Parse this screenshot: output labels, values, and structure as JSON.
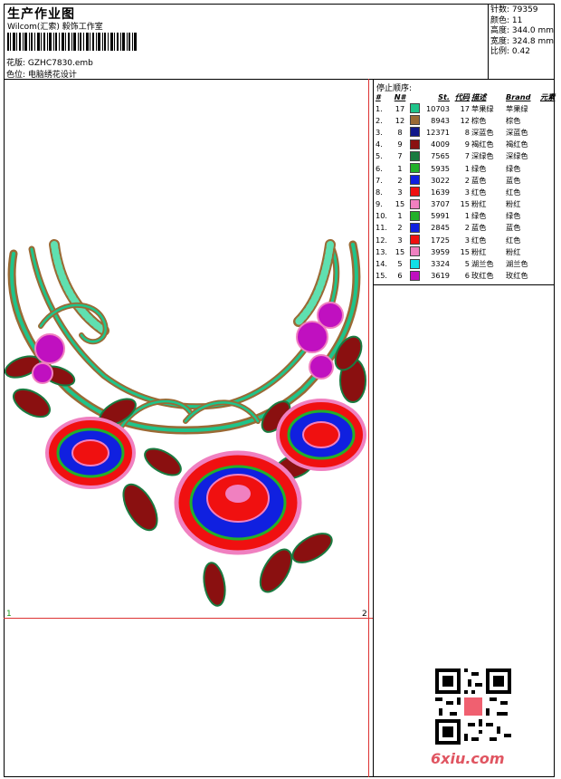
{
  "header": {
    "title": "生产作业图",
    "company": "Wilcom(汇索) 毅饰工作室",
    "pattern_label": "花版:",
    "pattern_value": "GZHC7830.emb",
    "color_label": "色位:",
    "color_value": "电脑绣花设计"
  },
  "stats": {
    "stitches": "针数: 79359",
    "colors": "颜色: 11",
    "height": "高度: 344.0 mm",
    "width": "宽度: 324.8 mm",
    "scale": "比例: 0.42"
  },
  "sequence": {
    "title": "停止顺序:",
    "headers": [
      "#",
      "N#",
      "St.",
      "代码",
      "描述",
      "Brand",
      "元素"
    ],
    "rows": [
      {
        "idx": "1.",
        "n": "17",
        "color": "#1fc48a",
        "st": "10703",
        "code": "17",
        "desc": "苹果绿",
        "brand": "苹果绿"
      },
      {
        "idx": "2.",
        "n": "12",
        "color": "#9a6a35",
        "st": "8943",
        "code": "12",
        "desc": "棕色",
        "brand": "棕色"
      },
      {
        "idx": "3.",
        "n": "8",
        "color": "#10188a",
        "st": "12371",
        "code": "8",
        "desc": "深蓝色",
        "brand": "深蓝色"
      },
      {
        "idx": "4.",
        "n": "9",
        "color": "#8a1010",
        "st": "4009",
        "code": "9",
        "desc": "褐红色",
        "brand": "褐红色"
      },
      {
        "idx": "5.",
        "n": "7",
        "color": "#1a7a40",
        "st": "7565",
        "code": "7",
        "desc": "深绿色",
        "brand": "深绿色"
      },
      {
        "idx": "6.",
        "n": "1",
        "color": "#22b02a",
        "st": "5935",
        "code": "1",
        "desc": "绿色",
        "brand": "绿色"
      },
      {
        "idx": "7.",
        "n": "2",
        "color": "#1020e0",
        "st": "3022",
        "code": "2",
        "desc": "蓝色",
        "brand": "蓝色"
      },
      {
        "idx": "8.",
        "n": "3",
        "color": "#f01010",
        "st": "1639",
        "code": "3",
        "desc": "红色",
        "brand": "红色"
      },
      {
        "idx": "9.",
        "n": "15",
        "color": "#f080c0",
        "st": "3707",
        "code": "15",
        "desc": "粉红",
        "brand": "粉红"
      },
      {
        "idx": "10.",
        "n": "1",
        "color": "#22b02a",
        "st": "5991",
        "code": "1",
        "desc": "绿色",
        "brand": "绿色"
      },
      {
        "idx": "11.",
        "n": "2",
        "color": "#1020e0",
        "st": "2845",
        "code": "2",
        "desc": "蓝色",
        "brand": "蓝色"
      },
      {
        "idx": "12.",
        "n": "3",
        "color": "#f01010",
        "st": "1725",
        "code": "3",
        "desc": "红色",
        "brand": "红色"
      },
      {
        "idx": "13.",
        "n": "15",
        "color": "#f080c0",
        "st": "3959",
        "code": "15",
        "desc": "粉红",
        "brand": "粉红"
      },
      {
        "idx": "14.",
        "n": "5",
        "color": "#10e0e8",
        "st": "3324",
        "code": "5",
        "desc": "湖兰色",
        "brand": "湖兰色"
      },
      {
        "idx": "15.",
        "n": "6",
        "color": "#c010c0",
        "st": "3619",
        "code": "6",
        "desc": "玫红色",
        "brand": "玫红色"
      }
    ]
  },
  "canvas": {
    "marker_left": "1",
    "marker_right": "2"
  },
  "footer": {
    "brand": "6xiu.com"
  }
}
